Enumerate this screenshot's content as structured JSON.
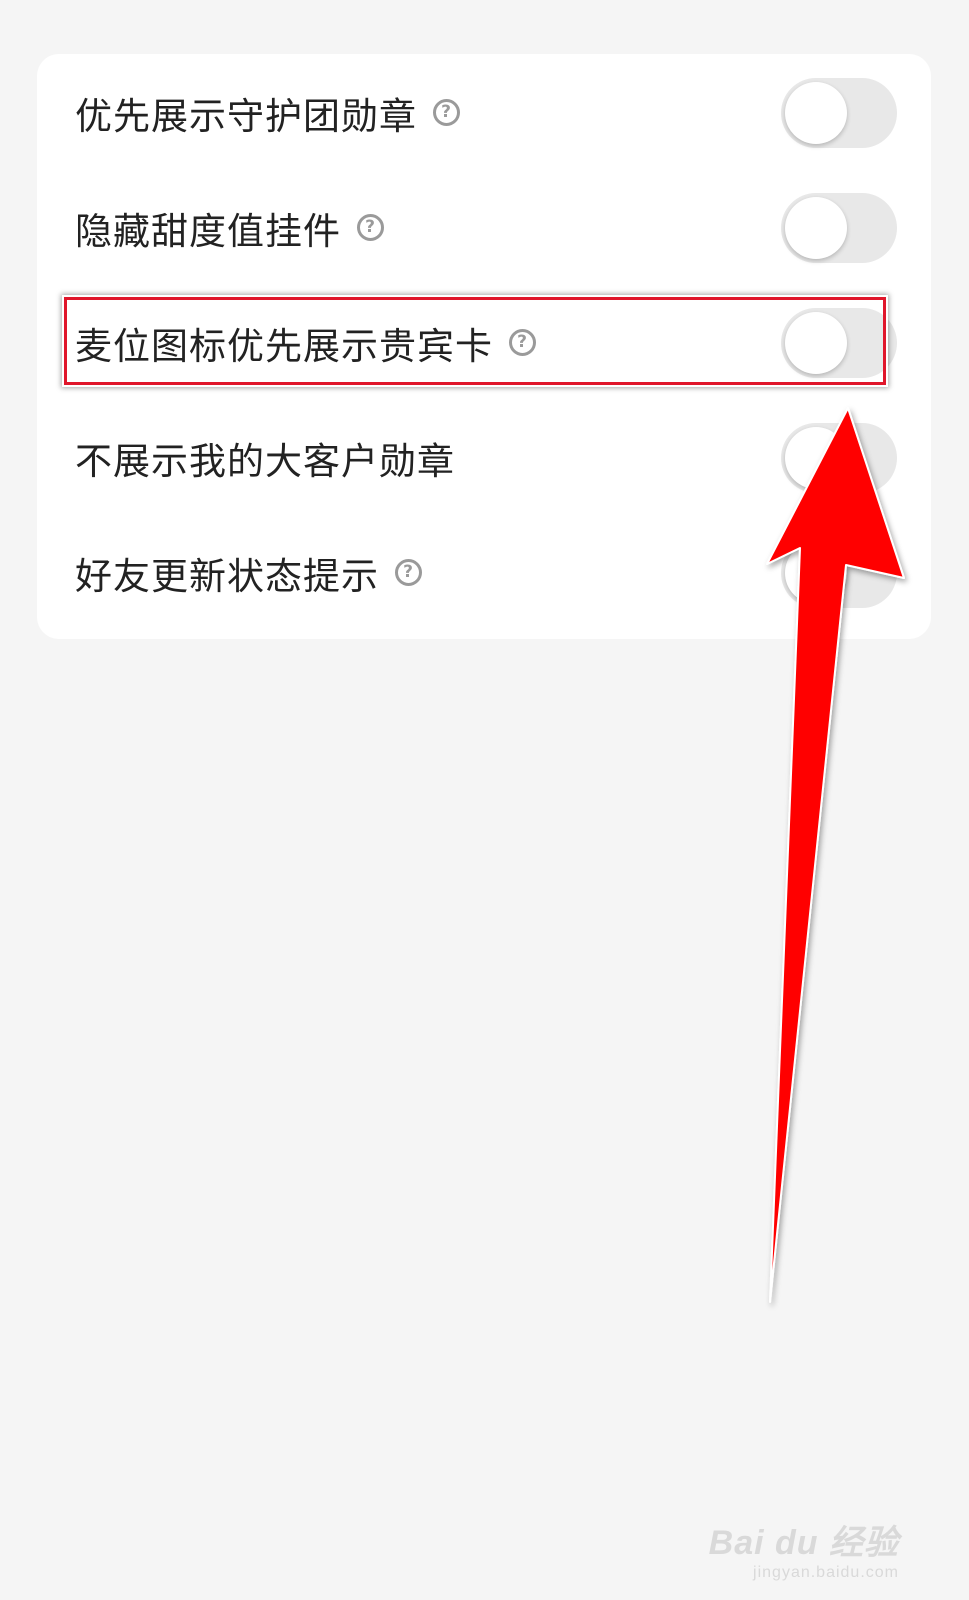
{
  "settings": {
    "items": [
      {
        "label": "优先展示守护团勋章",
        "has_help": true,
        "enabled": false
      },
      {
        "label": "隐藏甜度值挂件",
        "has_help": true,
        "enabled": false
      },
      {
        "label": "麦位图标优先展示贵宾卡",
        "has_help": true,
        "enabled": false,
        "highlighted": true
      },
      {
        "label": "不展示我的大客户勋章",
        "has_help": false,
        "enabled": false
      },
      {
        "label": "好友更新状态提示",
        "has_help": true,
        "enabled": false
      }
    ],
    "help_glyph": "?"
  },
  "annotation": {
    "highlight_color": "#e0162b",
    "arrow_color": "#ff0000"
  },
  "watermark": {
    "logo": "Bai du 经验",
    "url": "jingyan.baidu.com"
  }
}
